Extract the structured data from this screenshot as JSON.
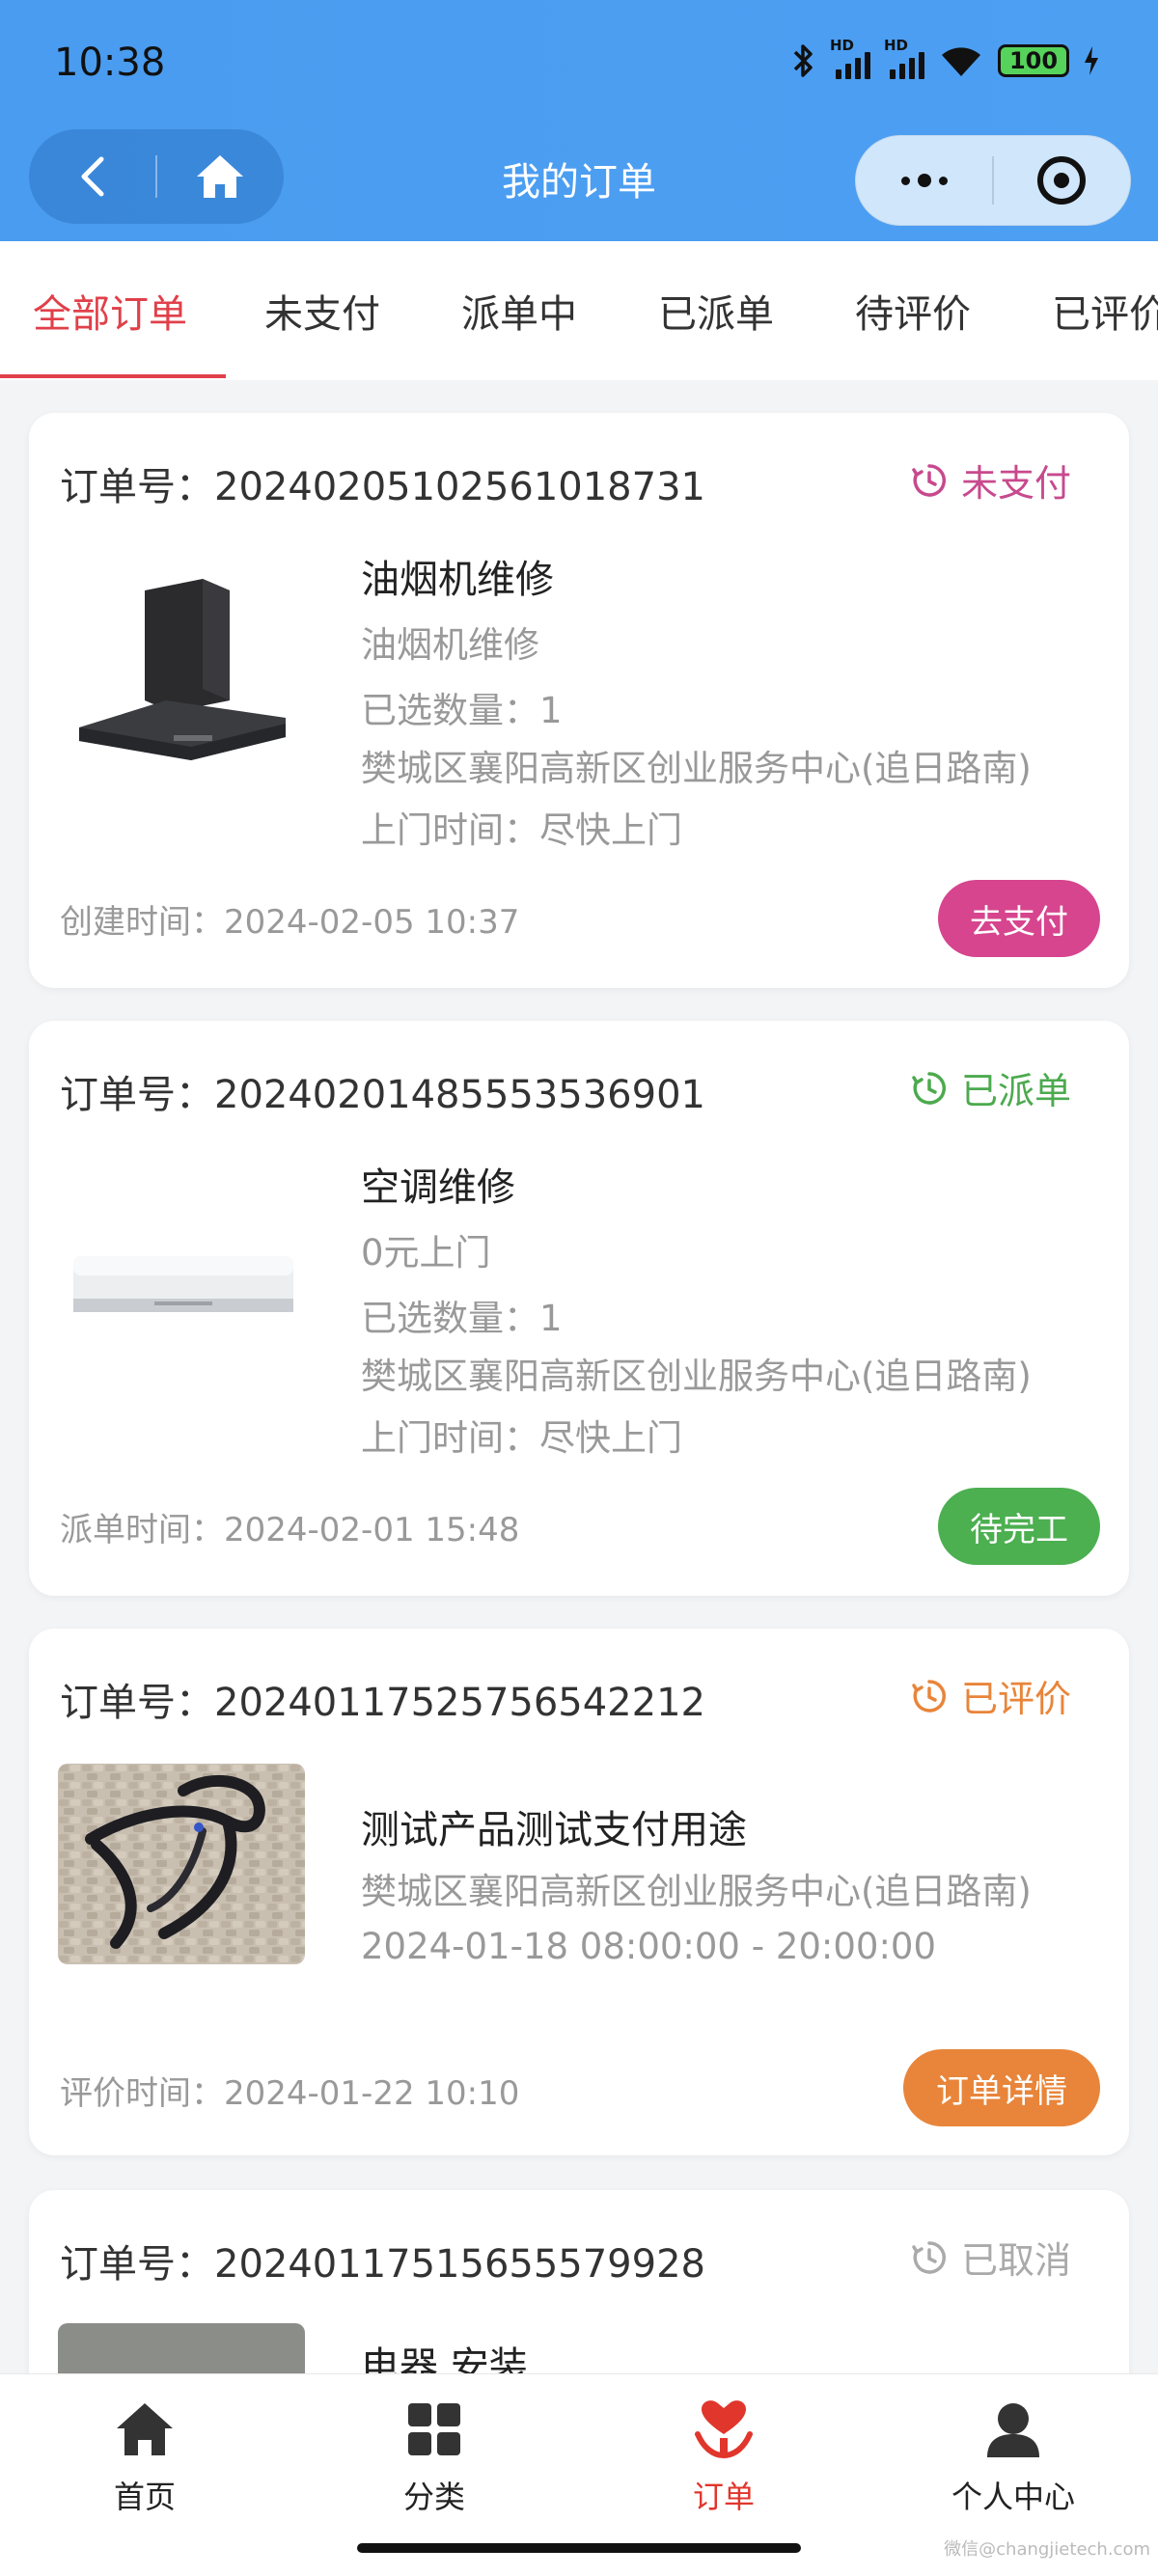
{
  "status_bar": {
    "time": "10:38",
    "battery": "100"
  },
  "nav": {
    "title": "我的订单"
  },
  "tabs": [
    "全部订单",
    "未支付",
    "派单中",
    "已派单",
    "待评价",
    "已评价"
  ],
  "orders": [
    {
      "order_no": "订单号：20240205102561018731",
      "status": "未支付",
      "status_color": "#c8498d",
      "name": "油烟机维修",
      "line2": "油烟机维修",
      "qty": "已选数量：1",
      "address": "樊城区襄阳高新区创业服务中心(追日路南)",
      "visit": "上门时间：尽快上门",
      "time_label": "创建时间：2024-02-05 10:37",
      "action": "去支付",
      "action_color": "#d6458e"
    },
    {
      "order_no": "订单号：20240201485553536901",
      "status": "已派单",
      "status_color": "#4caa4e",
      "name": "空调维修",
      "line2": "0元上门",
      "qty": "已选数量：1",
      "address": "樊城区襄阳高新区创业服务中心(追日路南)",
      "visit": "上门时间：尽快上门",
      "time_label": "派单时间：2024-02-01 15:48",
      "action": "待完工",
      "action_color": "#4caf50"
    },
    {
      "order_no": "订单号：20240117525756542212",
      "status": "已评价",
      "status_color": "#e8853a",
      "name": "测试产品测试支付用途",
      "address": "樊城区襄阳高新区创业服务中心(追日路南)",
      "date_range": "2024-01-18 08:00:00 - 20:00:00",
      "time_label": "评价时间：2024-01-22 10:10",
      "action": "订单详情",
      "action_color": "#e8853a"
    },
    {
      "order_no": "订单号：20240117515655579928",
      "status": "已取消",
      "status_color": "#aaaaaa",
      "name": "电器 安装"
    }
  ],
  "tabbar": [
    {
      "label": "首页",
      "icon": "home-icon"
    },
    {
      "label": "分类",
      "icon": "category-icon"
    },
    {
      "label": "订单",
      "icon": "order-heart-icon",
      "active_color": "#e0362c"
    },
    {
      "label": "个人中心",
      "icon": "user-icon"
    }
  ],
  "watermark": "微信@changjietech.com"
}
